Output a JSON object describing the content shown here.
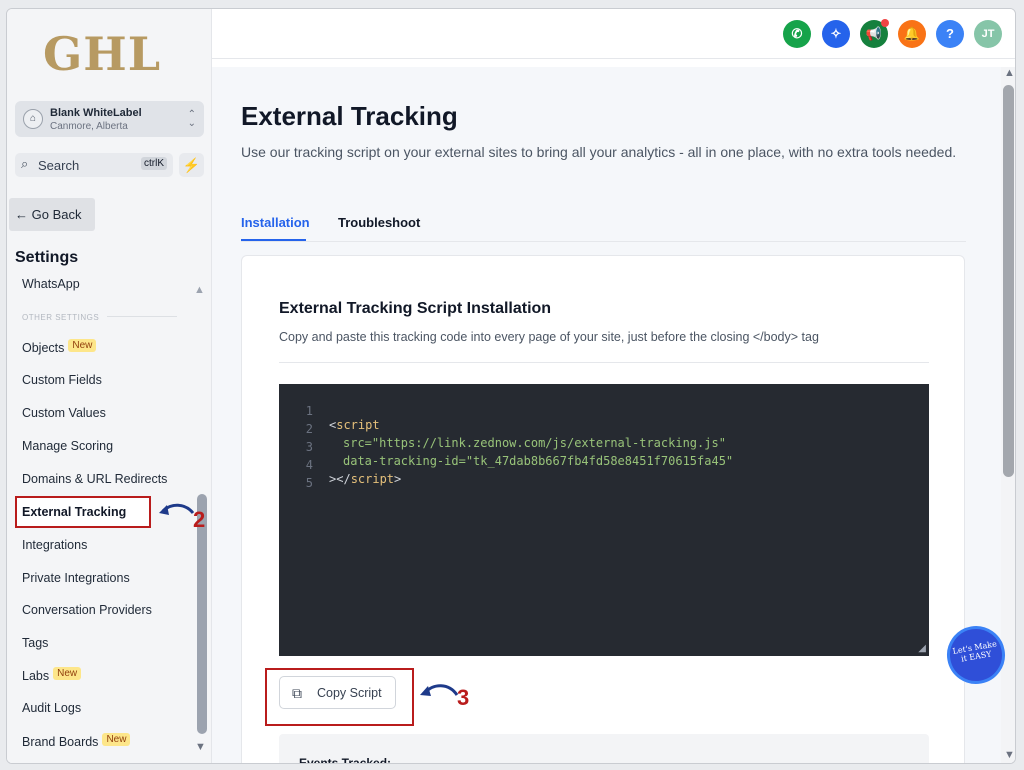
{
  "logo": "GHL",
  "account": {
    "name": "Blank WhiteLabel",
    "location": "Canmore, Alberta"
  },
  "search": {
    "label": "Search",
    "shortcut": "ctrlK"
  },
  "go_back": "← Go Back",
  "settings_title": "Settings",
  "other_settings_label": "OTHER SETTINGS",
  "nav": [
    {
      "label": "WhatsApp"
    },
    {
      "label": "Objects",
      "badge": "New"
    },
    {
      "label": "Custom Fields"
    },
    {
      "label": "Custom Values"
    },
    {
      "label": "Manage Scoring"
    },
    {
      "label": "Domains & URL Redirects"
    },
    {
      "label": "External Tracking",
      "active": true
    },
    {
      "label": "Integrations"
    },
    {
      "label": "Private Integrations"
    },
    {
      "label": "Conversation Providers"
    },
    {
      "label": "Tags"
    },
    {
      "label": "Labs",
      "badge": "New"
    },
    {
      "label": "Audit Logs"
    },
    {
      "label": "Brand Boards",
      "badge": "New"
    }
  ],
  "annotations": {
    "step2": "2",
    "step3": "3"
  },
  "topbar": {
    "user_initials": "JT"
  },
  "page": {
    "title": "External Tracking",
    "description": "Use our tracking script on your external sites to bring all your analytics - all in one place, with no extra tools needed.",
    "tabs": [
      "Installation",
      "Troubleshoot"
    ]
  },
  "card": {
    "title": "External Tracking Script Installation",
    "description": "Copy and paste this tracking code into every page of your site, just before the closing </body> tag",
    "code": {
      "line_numbers": [
        "1",
        "2",
        "3",
        "4",
        "5"
      ],
      "open_tag": "<",
      "script_kw": "script",
      "src_attr": "src=",
      "src_val": "\"https://link.zednow.com/js/external-tracking.js\"",
      "id_attr": "data-tracking-id=",
      "id_val": "\"tk_47dab8b667fb4fd58e8451f70615fa45\"",
      "close": "></",
      "close_end": ">"
    },
    "copy_button": "Copy Script",
    "events_label": "Events Tracked:"
  },
  "floating_badge": "Let's Make it EASY",
  "colors": {
    "accent": "#2563eb",
    "annotation": "#b91c1c",
    "code_bg": "#262a31"
  }
}
